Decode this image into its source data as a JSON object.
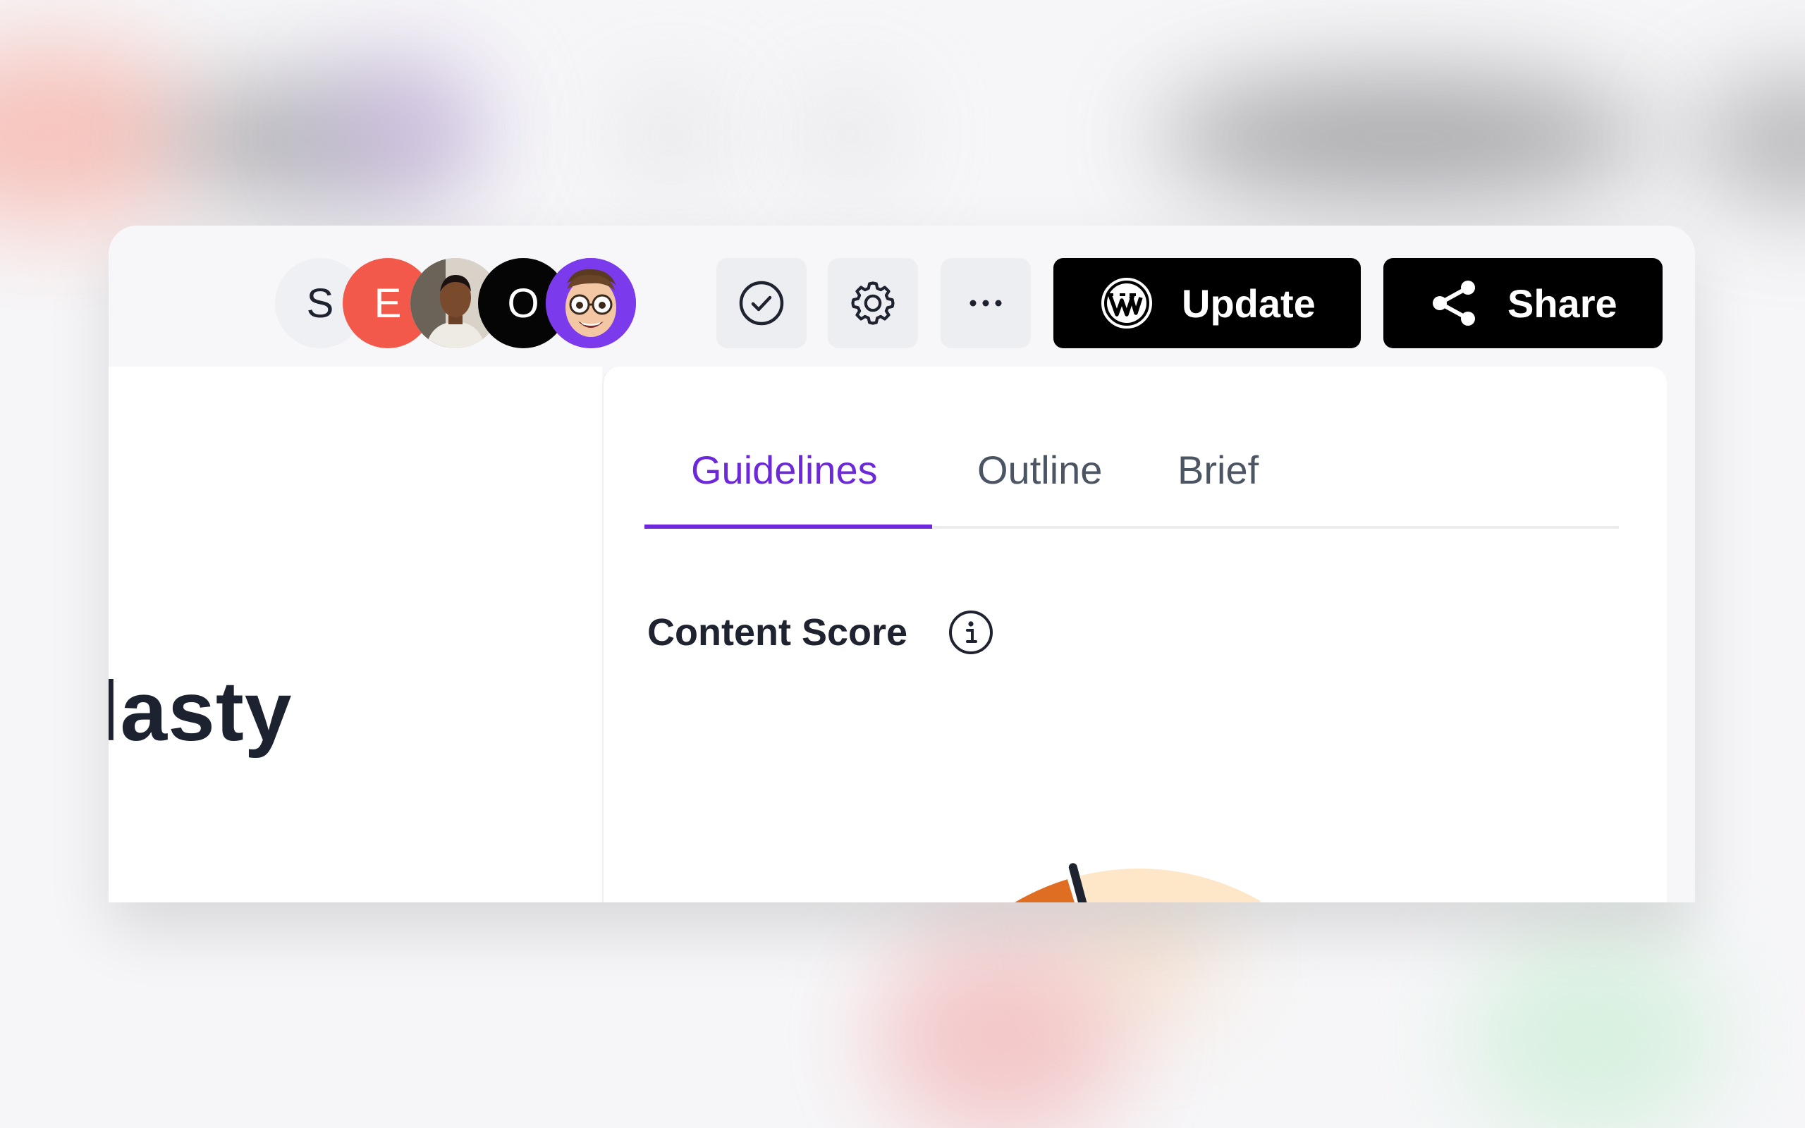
{
  "avatars": [
    {
      "label": "S",
      "bg": "#eef0f4"
    },
    {
      "label": "E",
      "bg": "#f2594b"
    },
    {
      "label": "",
      "bg": "#cfc7bd"
    },
    {
      "label": "O",
      "bg": "#050505"
    },
    {
      "label": "",
      "bg": "#7c3aed"
    }
  ],
  "toolbar": {
    "check_icon": "check-circle-icon",
    "settings_icon": "gear-icon",
    "more_icon": "more-horizontal-icon",
    "update_label": "Update",
    "update_icon": "wordpress-icon",
    "share_label": "Share",
    "share_icon": "share-icon"
  },
  "document": {
    "heading_fragment": "lasty"
  },
  "panel": {
    "tabs": [
      {
        "label": "Guidelines",
        "active": true
      },
      {
        "label": "Outline",
        "active": false
      },
      {
        "label": "Brief",
        "active": false
      }
    ],
    "content_score_label": "Content Score",
    "info_icon": "info-icon"
  },
  "gauge": {
    "score_fraction": 0.3,
    "colors": {
      "red": "#e0413f",
      "orange": "#e06e22",
      "peach": "#fde7c8",
      "green": "#c8f2d4",
      "accent": "#6d28d9",
      "needle": "#1f2330"
    }
  }
}
